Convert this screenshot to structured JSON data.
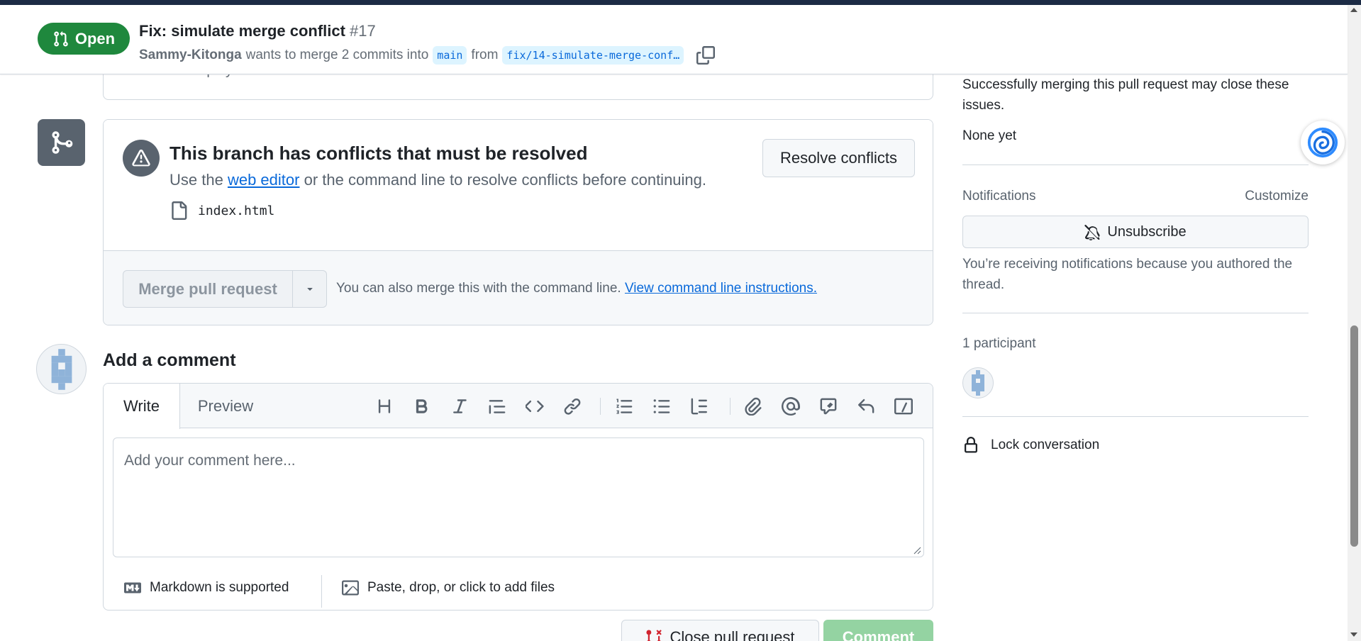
{
  "header": {
    "state_label": "Open",
    "title": "Fix: simulate merge conflict",
    "number": "#17",
    "author": "Sammy-Kitonga",
    "meta_text": "wants to merge 2 commits into",
    "base_branch": "main",
    "from_text": "from",
    "head_branch": "fix/14-simulate-merge-conf…"
  },
  "deployments": {
    "text": "No deployments"
  },
  "merge_box": {
    "conflict_title": "This branch has conflicts that must be resolved",
    "desc_prefix": "Use the",
    "desc_link": "web editor",
    "desc_suffix": "or the command line to resolve conflicts before continuing.",
    "conflict_file": "index.html",
    "resolve_button": "Resolve conflicts",
    "merge_button": "Merge pull request",
    "merge_note": "You can also merge this with the command line.",
    "merge_note_link": "View command line instructions."
  },
  "comment": {
    "title": "Add a comment",
    "tab_write": "Write",
    "tab_preview": "Preview",
    "placeholder": "Add your comment here...",
    "markdown_note": "Markdown is supported",
    "attach_note": "Paste, drop, or click to add files",
    "close_button": "Close pull request",
    "comment_button": "Comment",
    "toolbar_icons": [
      "heading-icon",
      "bold-icon",
      "italic-icon",
      "quote-icon",
      "code-icon",
      "link-icon",
      "numbered-list-icon",
      "unordered-list-icon",
      "task-list-icon",
      "attach-icon",
      "mention-icon",
      "reference-icon",
      "saved-reply-icon",
      "slash-command-icon"
    ]
  },
  "sidebar": {
    "development_text": "Successfully merging this pull request may close these issues.",
    "development_none": "None yet",
    "notifications_heading": "Notifications",
    "notifications_customize": "Customize",
    "unsubscribe_label": "Unsubscribe",
    "notifications_reason": "You’re receiving notifications because you authored the thread.",
    "participants_heading": "1 participant",
    "lock_label": "Lock conversation"
  },
  "colors": {
    "open_green": "#1f883d",
    "link_blue": "#0969da",
    "border": "#d0d7de",
    "muted_text": "#59636e",
    "comment_button_disabled": "#94d3a2"
  }
}
